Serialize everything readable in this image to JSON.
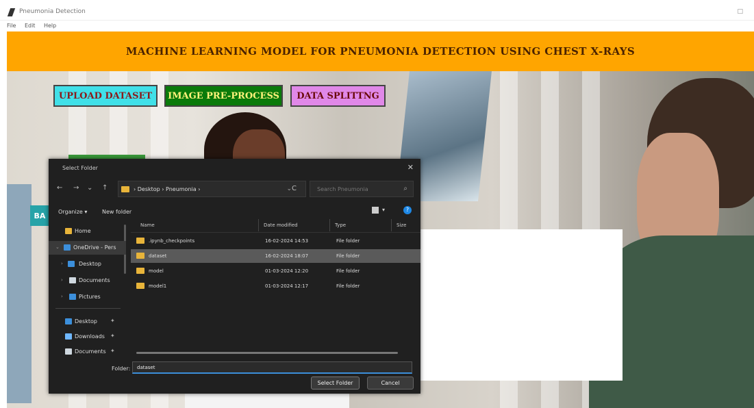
{
  "window": {
    "title": "Pneumonia Detection",
    "maximize_glyph": "□"
  },
  "menubar": {
    "items": [
      "File",
      "Edit",
      "Help"
    ]
  },
  "banner": {
    "title": "MACHINE LEARNING MODEL FOR PNEUMONIA DETECTION USING CHEST X-RAYS",
    "color": "#ffa500"
  },
  "buttons": {
    "upload": "UPLOAD DATASET",
    "preprocess": "IMAGE PRE-PROCESS",
    "split": "DATA SPLITTNG",
    "partial_left": "BA"
  },
  "dialog": {
    "title": "Select Folder",
    "close_glyph": "✕",
    "nav": {
      "back": "←",
      "forward": "→",
      "dropdown": "⌄",
      "up": "↑"
    },
    "breadcrumb": "›  Desktop  ›  Pneumonia  ›",
    "breadcrumb_dropdown": "⌄",
    "refresh_glyph": "C",
    "search_placeholder": "Search Pneumonia",
    "search_glyph": "⌕",
    "organize": "Organize ▾",
    "new_folder": "New folder",
    "view_dropdown": "▾",
    "help": "?",
    "nav_pane": [
      {
        "label": "Home",
        "icon": "home-icon",
        "color": "#e8b43a"
      },
      {
        "label": "OneDrive - Pers",
        "icon": "cloud-icon",
        "color": "#3c8fdb"
      },
      {
        "label": "Desktop",
        "icon": "desktop-icon",
        "color": "#3c8fdb"
      },
      {
        "label": "Documents",
        "icon": "documents-icon",
        "color": "#cfd8e0"
      },
      {
        "label": "Pictures",
        "icon": "pictures-icon",
        "color": "#3c8fdb"
      },
      {
        "label": "Desktop",
        "icon": "desktop-icon",
        "color": "#3c8fdb"
      },
      {
        "label": "Downloads",
        "icon": "download-icon",
        "color": "#6fb7ff"
      },
      {
        "label": "Documents",
        "icon": "documents-icon",
        "color": "#cfd8e0"
      }
    ],
    "pin_glyph": "✦",
    "chevron_glyph": "›",
    "expand_glyph": "⌄",
    "columns": [
      "Name",
      "Date modified",
      "Type",
      "Size"
    ],
    "files": [
      {
        "name": ".ipynb_checkpoints",
        "date": "16-02-2024 14:53",
        "type": "File folder"
      },
      {
        "name": "dataset",
        "date": "16-02-2024 18:07",
        "type": "File folder"
      },
      {
        "name": "model",
        "date": "01-03-2024 12:20",
        "type": "File folder"
      },
      {
        "name": "model1",
        "date": "01-03-2024 12:17",
        "type": "File folder"
      }
    ],
    "folder_label": "Folder:",
    "folder_value": "dataset",
    "select_button": "Select Folder",
    "cancel_button": "Cancel"
  }
}
